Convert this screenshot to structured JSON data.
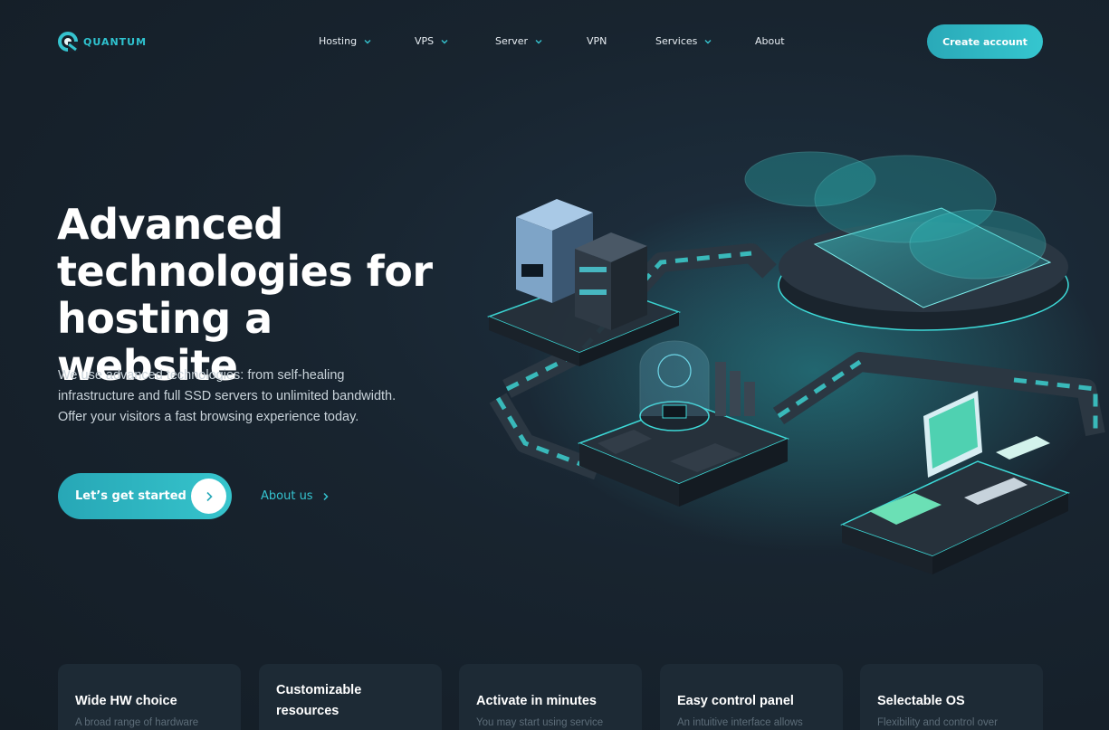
{
  "brand": {
    "name": "QUANTUM",
    "accent": "#35c3cf"
  },
  "nav": {
    "items": [
      {
        "label": "Hosting",
        "has_dropdown": true
      },
      {
        "label": "VPS",
        "has_dropdown": true
      },
      {
        "label": "Server",
        "has_dropdown": true
      },
      {
        "label": "VPN",
        "has_dropdown": false
      },
      {
        "label": "Services",
        "has_dropdown": true
      },
      {
        "label": "About",
        "has_dropdown": false
      }
    ],
    "cta_label": "Create account"
  },
  "hero": {
    "title_line1": "Advanced",
    "title_line2": "technologies for",
    "title_line3": "hosting a website",
    "subtitle_line1": "We use advanced technologies: from self-healing",
    "subtitle_line2": "infrastructure and full SSD servers to unlimited bandwidth.",
    "subtitle_line3": "Offer your visitors a fast browsing experience today.",
    "primary_button": "Let’s get started",
    "secondary_link": "About us"
  },
  "features": [
    {
      "title": "Wide HW choice",
      "desc": "A broad range of hardware"
    },
    {
      "title": "Customizable resources",
      "desc": ""
    },
    {
      "title": "Activate in minutes",
      "desc": "You may start using service"
    },
    {
      "title": "Easy control panel",
      "desc": "An intuitive interface allows"
    },
    {
      "title": "Selectable OS",
      "desc": "Flexibility and control over"
    }
  ]
}
